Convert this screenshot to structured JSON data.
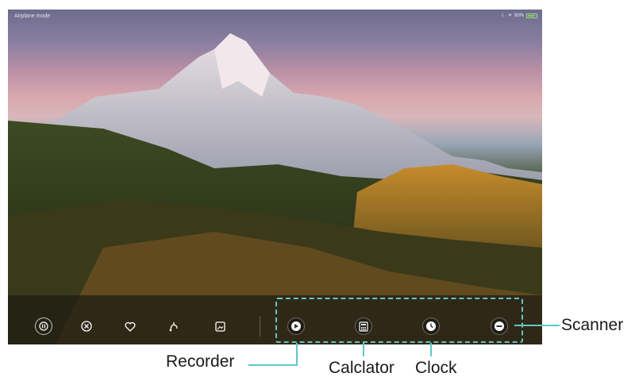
{
  "status_bar": {
    "left_text": "Airplane mode",
    "right_text": "90%",
    "icons": [
      "moon-icon",
      "airplane-icon",
      "battery-icon"
    ]
  },
  "quick_controls": [
    {
      "name": "pause-button",
      "icon": "pause-icon"
    },
    {
      "name": "close-button",
      "icon": "close-circle-icon"
    },
    {
      "name": "favorite-button",
      "icon": "heart-icon"
    },
    {
      "name": "share-button",
      "icon": "share-icon"
    },
    {
      "name": "wallpaper-button",
      "icon": "image-icon"
    }
  ],
  "shortcuts": [
    {
      "name": "recorder-shortcut",
      "icon": "recorder-icon",
      "label": "Recorder"
    },
    {
      "name": "calculator-shortcut",
      "icon": "calculator-icon",
      "label": "Calclator"
    },
    {
      "name": "clock-shortcut",
      "icon": "clock-icon",
      "label": "Clock"
    },
    {
      "name": "scanner-shortcut",
      "icon": "scanner-icon",
      "label": "Scanner"
    }
  ],
  "colors": {
    "highlight": "#5fc6c8"
  }
}
